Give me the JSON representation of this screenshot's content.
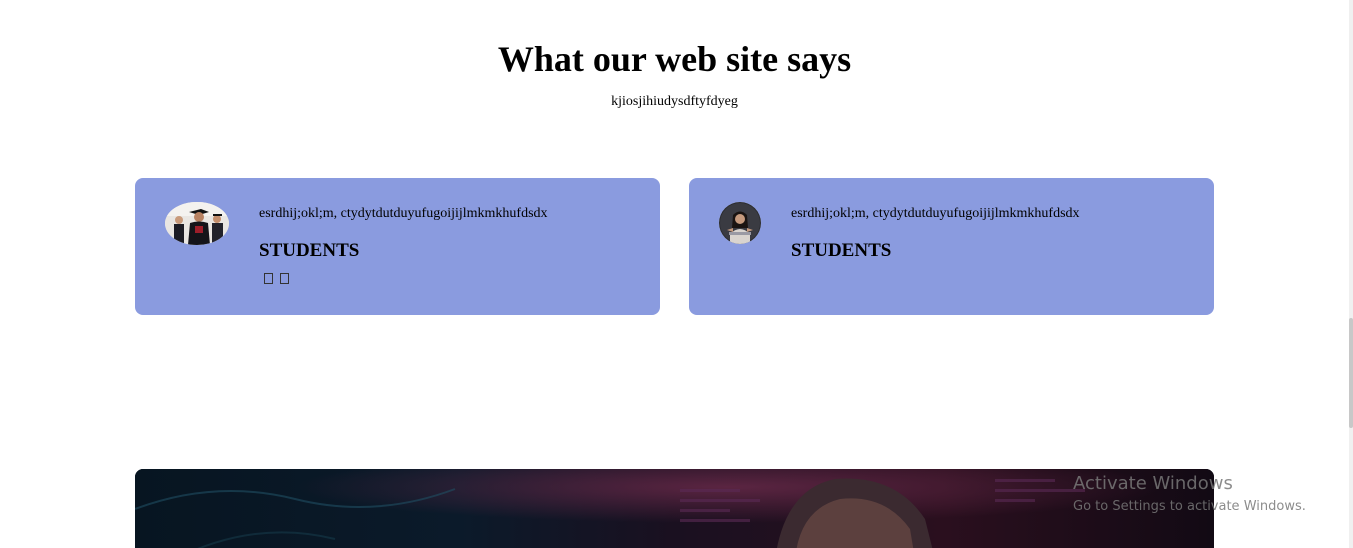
{
  "section": {
    "title": "What our web site says",
    "subtitle": "kjiosjihiudysdftyfdyeg"
  },
  "testimonials": [
    {
      "quote": "esrdhij;okl;m, ctydytdutduyufugoijijlmkmkhufdsdx",
      "role": "STUDENTS",
      "avatar": "graduates-photo",
      "icons": [
        "missing-glyph-icon",
        "missing-glyph-icon"
      ]
    },
    {
      "quote": "esrdhij;okl;m, ctydytdutduyufugoijijlmkmkhufdsdx",
      "role": "STUDENTS",
      "avatar": "woman-at-laptop-photo"
    }
  ],
  "banner": {
    "image": "cyber-hacker-photo"
  },
  "watermark": {
    "title": "Activate Windows",
    "subtitle": "Go to Settings to activate Windows."
  },
  "colors": {
    "card_background": "#8a9bdf",
    "page_background": "#ffffff",
    "banner_background": "#0a0d18"
  }
}
